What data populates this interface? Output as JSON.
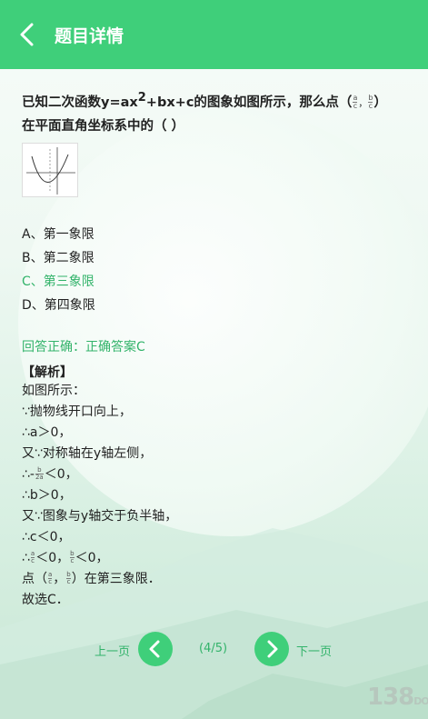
{
  "header": {
    "title": "题目详情"
  },
  "question": {
    "text_a": "已知二次函数y=ax",
    "sup": "2",
    "text_b": "+bx+c的图象如图所示，那么点（",
    "frac1": {
      "num": "a",
      "den": "c"
    },
    "comma": "，",
    "frac2": {
      "num": "b",
      "den": "c"
    },
    "text_c": "）",
    "text_d": "在平面直角坐标系中的（  ）"
  },
  "options": [
    {
      "label": "A、第一象限",
      "correct": false
    },
    {
      "label": "B、第二象限",
      "correct": false
    },
    {
      "label": "C、第三象限",
      "correct": true
    },
    {
      "label": "D、第四象限",
      "correct": false
    }
  ],
  "answer": "回答正确：正确答案C",
  "analysis": {
    "title": "【解析】",
    "l1": "如图所示：",
    "l2": "∵抛物线开口向上，",
    "l3": "∴a＞0，",
    "l4": "又∵对称轴在y轴左侧，",
    "l5a": "∴-",
    "l5frac": {
      "num": "b",
      "den": "2a"
    },
    "l5b": "＜0，",
    "l6": "∴b＞0，",
    "l7": "又∵图象与y轴交于负半轴，",
    "l8": "∴c＜0，",
    "l9a": "∴",
    "l9f1": {
      "num": "a",
      "den": "c"
    },
    "l9b": "＜0，",
    "l9f2": {
      "num": "b",
      "den": "c"
    },
    "l9c": "＜0，",
    "l10a": "点（",
    "l10f1": {
      "num": "a",
      "den": "c"
    },
    "l10b": "，",
    "l10f2": {
      "num": "b",
      "den": "c"
    },
    "l10c": "）在第三象限．",
    "l11": "故选C．"
  },
  "nav": {
    "prev": "上一页",
    "page": "(4/5)",
    "next": "下一页"
  },
  "watermark": {
    "num": "138",
    "word": "DOWN"
  },
  "colors": {
    "header": "#3fcf7a",
    "accent": "#32b36a"
  }
}
